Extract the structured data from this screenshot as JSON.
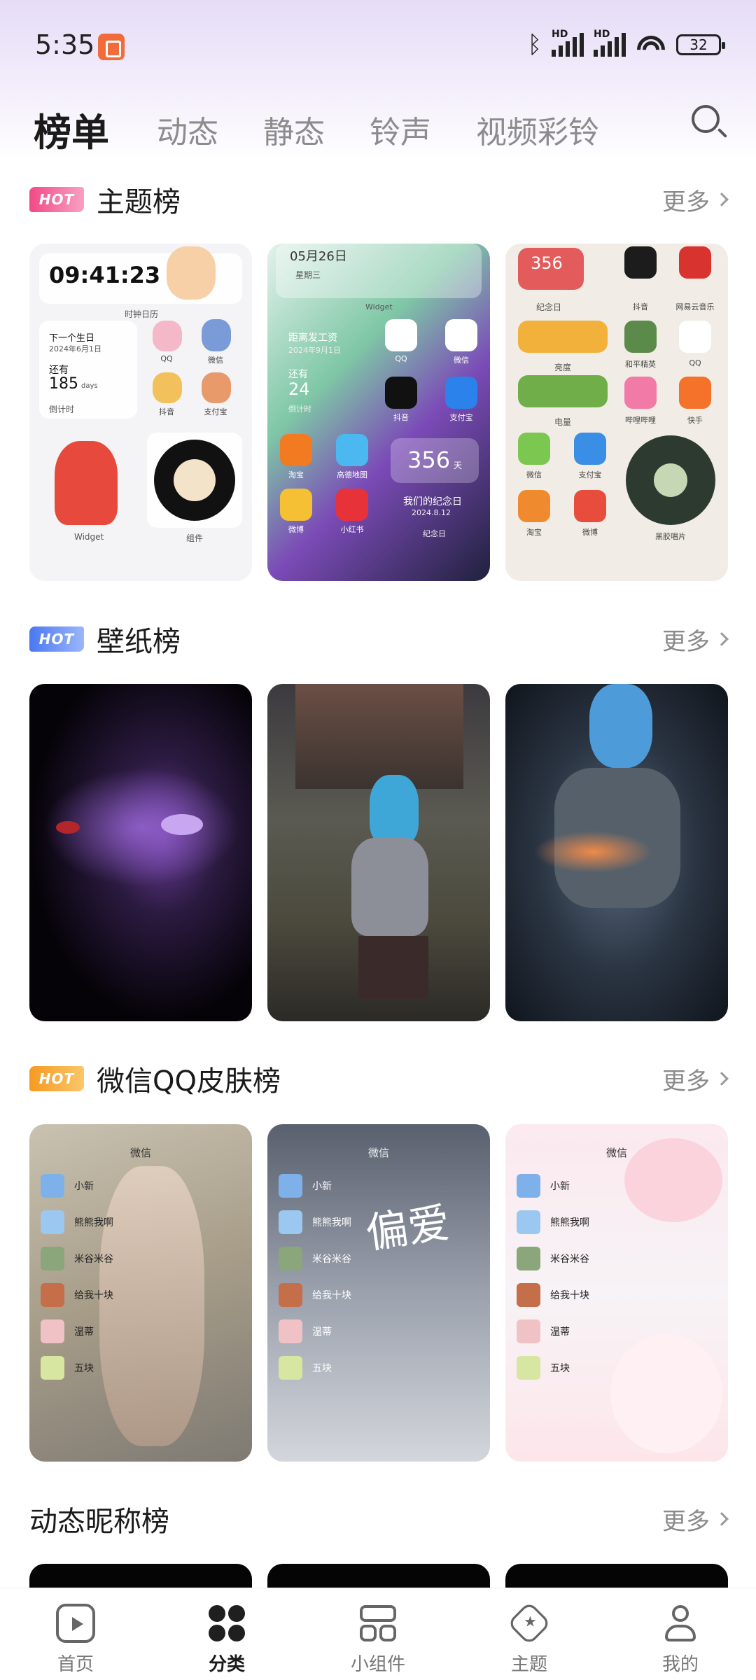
{
  "status_bar": {
    "time": "5:35",
    "signal1_label": "HD",
    "signal2_label": "HD",
    "battery": "32"
  },
  "tabs": [
    {
      "label": "榜单",
      "active": true
    },
    {
      "label": "动态",
      "active": false
    },
    {
      "label": "静态",
      "active": false
    },
    {
      "label": "铃声",
      "active": false
    },
    {
      "label": "视频彩铃",
      "active": false
    }
  ],
  "more_label": "更多",
  "hot_badge": "HOT",
  "sections": {
    "themes": {
      "title": "主题榜",
      "cards": [
        {
          "clock": "09:41:23",
          "clock_caption": "时钟日历",
          "birthday_title": "下一个生日",
          "birthday_date": "2024年6月1日",
          "remaining": "还有",
          "days": "185",
          "days_unit": "days",
          "countdown": "倒计时",
          "apps": [
            "QQ",
            "微信",
            "抖音",
            "支付宝"
          ],
          "widget_label": "Widget",
          "component_label": "组件"
        },
        {
          "date": "05月26日",
          "weekday": "星期三",
          "widget_label": "Widget",
          "payday_title": "距离发工资",
          "payday_date": "2024年9月1日",
          "remaining": "还有",
          "days": "24",
          "countdown": "倒计时",
          "apps": [
            "QQ",
            "微信",
            "抖音",
            "支付宝",
            "淘宝",
            "高德地图",
            "微博",
            "小红书"
          ],
          "anniv_days": "356",
          "anniv_unit": "天",
          "anniv_title": "我们的纪念日",
          "anniv_date": "2024.8.12",
          "anniv_caption": "纪念日"
        },
        {
          "anniv_days": "356",
          "anniv_caption": "纪念日",
          "apps": [
            "抖音",
            "网易云音乐",
            "亮度",
            "和平精英",
            "QQ",
            "电量",
            "哔哩哔哩",
            "快手",
            "微信",
            "支付宝",
            "淘宝",
            "微博",
            "黑胶唱片"
          ]
        }
      ]
    },
    "wallpapers": {
      "title": "壁纸榜"
    },
    "skins": {
      "title": "微信QQ皮肤榜",
      "cards": [
        {
          "header": "微信",
          "contacts": [
            "小新",
            "熊熊我啊",
            "米谷米谷",
            "给我十块",
            "温蒂",
            "五块"
          ]
        },
        {
          "header": "微信",
          "contacts": [
            "小新",
            "熊熊我啊",
            "米谷米谷",
            "给我十块",
            "温蒂",
            "五块"
          ],
          "overlay_text": "偏爱"
        },
        {
          "header": "微信",
          "contacts": [
            "小新",
            "熊熊我啊",
            "米谷米谷",
            "给我十块",
            "温蒂",
            "五块"
          ]
        }
      ]
    },
    "nicknames": {
      "title": "动态昵称榜"
    }
  },
  "bottom_nav": [
    {
      "label": "首页",
      "icon": "play-circle-icon",
      "active": false
    },
    {
      "label": "分类",
      "icon": "four-dots-icon",
      "active": true
    },
    {
      "label": "小组件",
      "icon": "widget-grid-icon",
      "active": false
    },
    {
      "label": "主题",
      "icon": "theme-star-icon",
      "active": false
    },
    {
      "label": "我的",
      "icon": "person-icon",
      "active": false
    }
  ],
  "colors": {
    "hot_pink": "#f04a86",
    "hot_blue": "#4a78f2",
    "hot_orange": "#f59a22",
    "active_text": "#1a1a1a",
    "inactive_text": "#8c8c8c"
  }
}
